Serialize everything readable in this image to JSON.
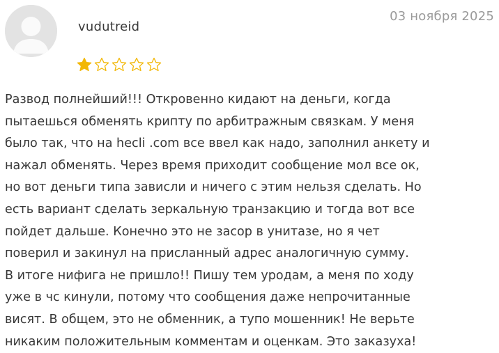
{
  "review": {
    "author": "vudutreid",
    "date": "03 ноября 2025",
    "rating": 1,
    "rating_max": 5,
    "star_filled_color": "#f2b705",
    "star_empty_color": "#f2b705",
    "avatar_icon": "user-avatar-icon",
    "text_lines": [
      "Развод полнейший!!! Откровенно кидают на деньги, когда",
      "пытаешься обменять крипту по арбитражным связкам. У меня",
      "было так, что на hecli .com все ввел как надо, заполнил анкету и",
      "нажал обменять. Через время приходит сообщение мол все ок,",
      "но вот деньги типа зависли и ничего с этим нельзя сделать. Но",
      "есть вариант сделать зеркальную транзакцию и тогда вот все",
      "пойдет дальше. Конечно это не засор в унитазе, но я чет",
      "поверил и закинул на присланный адрес аналогичную сумму.",
      "В итоге нифига не пришло!! Пишу тем уродам, а меня по ходу",
      "уже в чс кинули, потому что сообщения даже непрочитанные",
      "висят. В общем, это не обменник, а тупо мошенник! Не верьте",
      "никаким положительным комментам и оценкам. Это заказуха!"
    ]
  }
}
